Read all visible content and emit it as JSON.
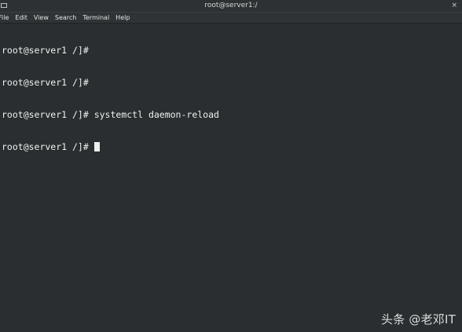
{
  "window": {
    "title": "root@server1:/",
    "close_glyph": "×",
    "menu_icon": "window-menu-icon"
  },
  "menubar": {
    "items": [
      "File",
      "Edit",
      "View",
      "Search",
      "Terminal",
      "Help"
    ]
  },
  "terminal": {
    "lines": [
      {
        "prompt": "root@server1 /]#",
        "command": ""
      },
      {
        "prompt": "root@server1 /]#",
        "command": ""
      },
      {
        "prompt": "root@server1 /]#",
        "command": " systemctl daemon-reload"
      },
      {
        "prompt": "root@server1 /]#",
        "command": " "
      }
    ]
  },
  "watermark": {
    "text": "头条 @老邓IT"
  },
  "colors": {
    "background": "#2a2e30",
    "text": "#eff0f0"
  }
}
